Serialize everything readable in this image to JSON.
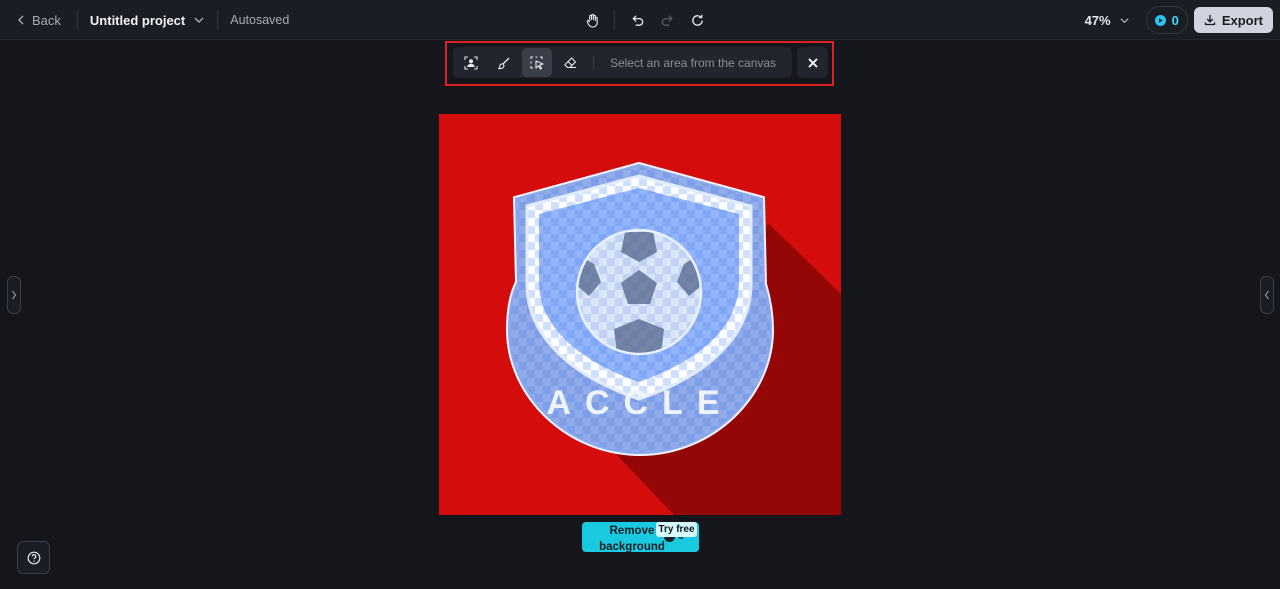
{
  "topbar": {
    "back_label": "Back",
    "project_name": "Untitled project",
    "autosave_status": "Autosaved",
    "zoom": "47%",
    "credits": "0",
    "export_label": "Export"
  },
  "toolbar": {
    "tools": [
      "person-select-icon",
      "brush-icon",
      "area-select-icon",
      "eraser-icon"
    ],
    "active_tool": "area-select-icon",
    "hint": "Select an area from the canvas"
  },
  "canvas": {
    "background_color": "#d40c0c",
    "badge_text": "ACCLE"
  },
  "remove_bg": {
    "label": "Remove background",
    "badge": "Try free",
    "credit_cost": "0"
  },
  "colors": {
    "accent": "#18c9e0",
    "highlight_border": "#e02020"
  }
}
